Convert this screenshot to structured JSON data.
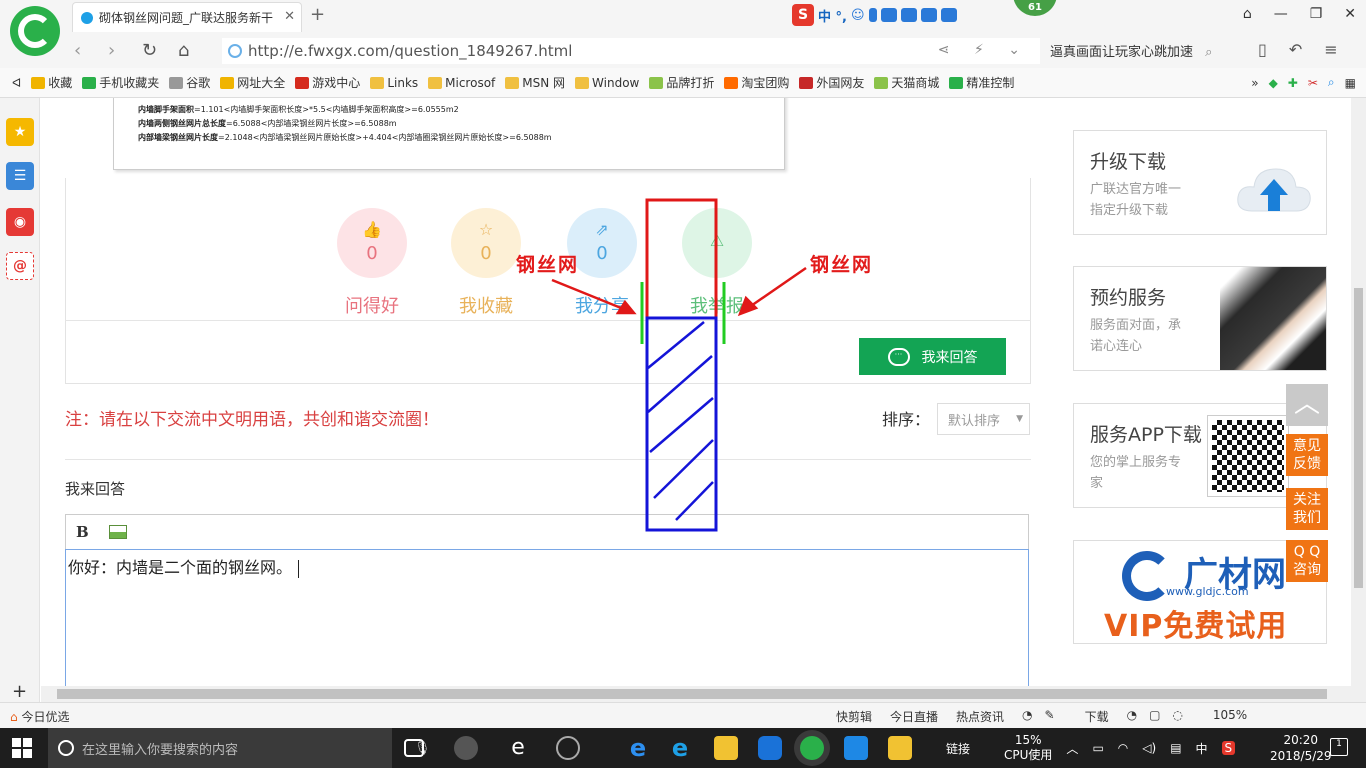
{
  "browser": {
    "tab_title": "砌体钢丝网问题_广联达服务新干",
    "url": "http://e.fwxgx.com/question_1849267.html",
    "search_hint": "逼真画面让玩家心跳加速",
    "badge_count": "61",
    "ime_lang": "中 °,",
    "colors": {
      "accent": "#2ab04a",
      "link": "#1ea0e6"
    }
  },
  "bookmarks": [
    {
      "label": "收藏",
      "icon": "star-icon",
      "color": "#f0b400"
    },
    {
      "label": "手机收藏夹",
      "icon": "phone-icon",
      "color": "#2ab04a"
    },
    {
      "label": "谷歌",
      "icon": "page-icon",
      "color": "#999999"
    },
    {
      "label": "网址大全",
      "icon": "globe-icon",
      "color": "#f0b400"
    },
    {
      "label": "游戏中心",
      "icon": "game-icon",
      "color": "#d52b1e"
    },
    {
      "label": "Links",
      "icon": "folder-icon",
      "color": "#f0c040"
    },
    {
      "label": "Microsof",
      "icon": "folder-icon",
      "color": "#f0c040"
    },
    {
      "label": "MSN 网",
      "icon": "folder-icon",
      "color": "#f0c040"
    },
    {
      "label": "Window",
      "icon": "folder-icon",
      "color": "#f0c040"
    },
    {
      "label": "品牌打折",
      "icon": "leaf-icon",
      "color": "#8bc34a"
    },
    {
      "label": "淘宝团购",
      "icon": "taobao-icon",
      "color": "#ff6a00"
    },
    {
      "label": "外国网友",
      "icon": "flag-icon",
      "color": "#c62828"
    },
    {
      "label": "天猫商城",
      "icon": "leaf-icon",
      "color": "#8bc34a"
    },
    {
      "label": "精准控制",
      "icon": "chat-icon",
      "color": "#2ab04a"
    }
  ],
  "document_snippet": [
    {
      "bold": "内墙脚手架面积",
      "rest": "=1.101<内墙脚手架面积长度>*5.5<内墙脚手架面积高度>=6.0555m2"
    },
    {
      "bold": "内墙两侧钢丝网片总长度",
      "rest": "=6.5088<内部墙梁钢丝网片长度>=6.5088m"
    },
    {
      "bold": "内部墙梁钢丝网片长度",
      "rest": "=2.1048<内部墙梁钢丝网片原始长度>+4.404<内部墙圈梁钢丝网片原始长度>=6.5088m"
    }
  ],
  "actions": [
    {
      "label": "问得好",
      "count": "0",
      "icon": "thumbs-up-icon",
      "glyph": "👍",
      "bg": "#fde3e6",
      "color": "#e8737f"
    },
    {
      "label": "我收藏",
      "count": "0",
      "icon": "star-outline-icon",
      "glyph": "☆",
      "bg": "#fdf0d6",
      "color": "#e8b25a"
    },
    {
      "label": "我分享",
      "count": "0",
      "icon": "share-icon",
      "glyph": "⇗",
      "bg": "#dbeefa",
      "color": "#4da6e0"
    },
    {
      "label": "我举报",
      "count": "",
      "icon": "warning-icon",
      "glyph": "⚠",
      "bg": "#def5e6",
      "color": "#5cbf7a"
    }
  ],
  "answer_button": {
    "label": "我来回答",
    "icon": "chat-bubble-icon"
  },
  "notice": "注：请在以下交流中文明用语，共创和谐交流圈！",
  "sort": {
    "label": "排序：",
    "selected": "默认排序"
  },
  "reply": {
    "title": "我来回答",
    "bold_label": "B",
    "content": "你好：内墙是二个面的钢丝网。"
  },
  "sidebar_cards": [
    {
      "title": "升级下载",
      "desc_line1": "广联达官方唯一",
      "desc_line2": "指定升级下载"
    },
    {
      "title": "预约服务",
      "desc_line1": "服务面对面，承",
      "desc_line2": "诺心连心"
    },
    {
      "title": "服务APP下载",
      "desc_line1": "您的掌上服务专",
      "desc_line2": "家"
    },
    {
      "title": "广材网",
      "desc_line1": "www.gldjc.com",
      "desc_line2": "VIP免费试用"
    }
  ],
  "float_buttons": [
    {
      "line1": "意见",
      "line2": "反馈"
    },
    {
      "line1": "关注",
      "line2": "我们"
    },
    {
      "line1": "Q Q",
      "line2": "咨询"
    }
  ],
  "annotations": {
    "left_label": "钢丝网",
    "right_label": "钢丝网"
  },
  "statusbar": {
    "left": "今日优选",
    "items": [
      "快剪辑",
      "今日直播",
      "热点资讯",
      "下载",
      "105%"
    ]
  },
  "taskbar": {
    "search_placeholder": "在这里输入你要搜索的内容",
    "tray_link": "链接",
    "cpu_percent": "15%",
    "cpu_label": "CPU使用",
    "ime": "中",
    "time": "20:20",
    "date": "2018/5/29",
    "notifications": "1"
  }
}
